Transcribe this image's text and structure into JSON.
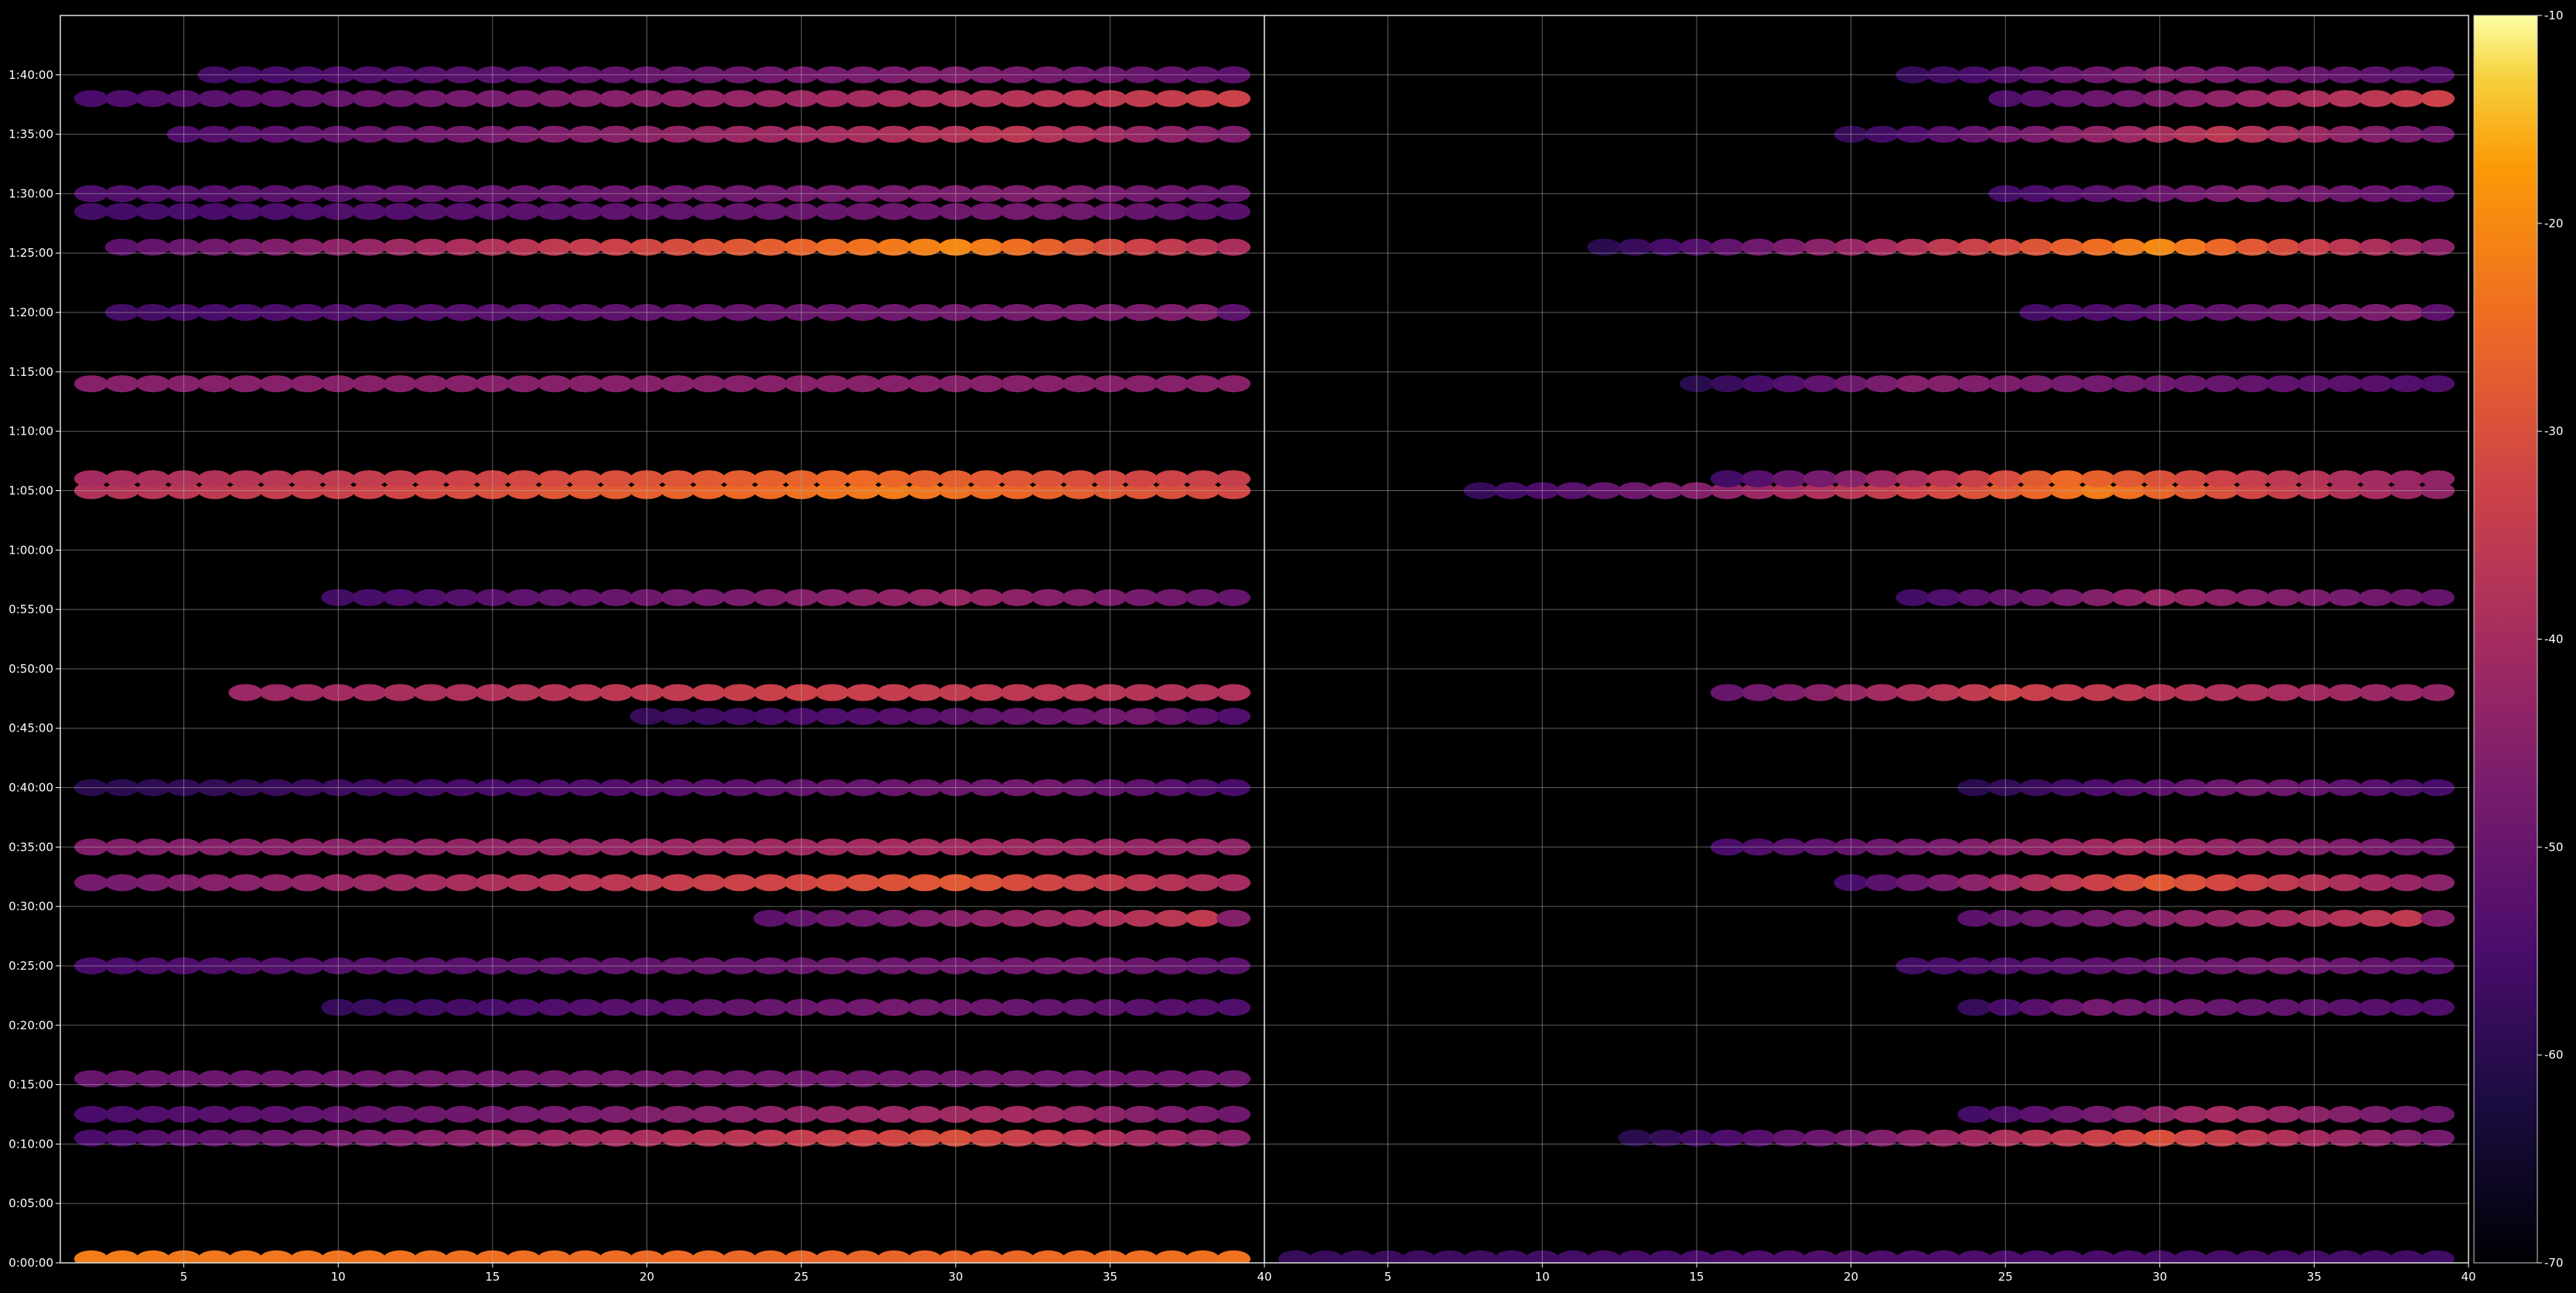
{
  "chart_data": {
    "type": "heatmap",
    "title": "",
    "background": "#000000",
    "grid": true,
    "colormap": "inferno",
    "colorbar": {
      "range": [
        -70,
        -10
      ],
      "ticks": [
        "-10",
        "-20",
        "-30",
        "-40",
        "-50",
        "-60",
        "-70"
      ],
      "tick_values": [
        -10,
        -20,
        -30,
        -40,
        -50,
        -60,
        -70
      ]
    },
    "y_axis": {
      "label": "",
      "range_seconds": [
        0,
        6300
      ],
      "ticks": [
        "0:00:00",
        "0:05:00",
        "0:10:00",
        "0:15:00",
        "0:20:00",
        "0:25:00",
        "0:30:00",
        "0:35:00",
        "0:40:00",
        "0:45:00",
        "0:50:00",
        "0:55:00",
        "1:00:00",
        "1:05:00",
        "1:10:00",
        "1:15:00",
        "1:20:00",
        "1:25:00",
        "1:30:00",
        "1:35:00",
        "1:40:00"
      ],
      "tick_seconds": [
        0,
        300,
        600,
        900,
        1200,
        1500,
        1800,
        2100,
        2400,
        2700,
        3000,
        3300,
        3600,
        3900,
        4200,
        4500,
        4800,
        5100,
        5400,
        5700,
        6000
      ]
    },
    "panels": [
      {
        "name": "",
        "x_range": [
          1,
          40
        ],
        "x_ticks": [
          "5",
          "10",
          "15",
          "20",
          "25",
          "30",
          "35",
          "40"
        ],
        "x_tick_values": [
          5,
          10,
          15,
          20,
          25,
          30,
          35,
          40
        ],
        "x_columns": [
          2,
          39
        ],
        "bands": [
          {
            "t": 20,
            "x_from": 2,
            "x_to": 39,
            "db_start": -22,
            "db_peak": -26,
            "peak_x": 28
          },
          {
            "t": 2880,
            "x_from": 7,
            "x_to": 39,
            "db_start": -42,
            "db_peak": -33,
            "peak_x": 25
          },
          {
            "t": 1920,
            "x_from": 2,
            "x_to": 39,
            "db_start": -48,
            "db_peak": -28,
            "peak_x": 30
          },
          {
            "t": 2100,
            "x_from": 2,
            "x_to": 39,
            "db_start": -46,
            "db_peak": -40,
            "peak_x": 29
          },
          {
            "t": 3900,
            "x_from": 2,
            "x_to": 39,
            "db_start": -38,
            "db_peak": -22,
            "peak_x": 28
          },
          {
            "t": 3960,
            "x_from": 2,
            "x_to": 39,
            "db_start": -40,
            "db_peak": -25,
            "peak_x": 27
          },
          {
            "t": 4440,
            "x_from": 2,
            "x_to": 39,
            "db_start": -45,
            "db_peak": -45,
            "peak_x": 20
          },
          {
            "t": 5130,
            "x_from": 3,
            "x_to": 39,
            "db_start": -52,
            "db_peak": -20,
            "peak_x": 30
          },
          {
            "t": 5700,
            "x_from": 5,
            "x_to": 39,
            "db_start": -54,
            "db_peak": -36,
            "peak_x": 32
          },
          {
            "t": 5880,
            "x_from": 2,
            "x_to": 39,
            "db_start": -55,
            "db_peak": -33,
            "peak_x": 39
          },
          {
            "t": 630,
            "x_from": 2,
            "x_to": 39,
            "db_start": -55,
            "db_peak": -30,
            "peak_x": 30
          },
          {
            "t": 750,
            "x_from": 2,
            "x_to": 39,
            "db_start": -55,
            "db_peak": -40,
            "peak_x": 32
          },
          {
            "t": 930,
            "x_from": 2,
            "x_to": 39,
            "db_start": -50,
            "db_peak": -48,
            "peak_x": 20
          },
          {
            "t": 1500,
            "x_from": 2,
            "x_to": 39,
            "db_start": -55,
            "db_peak": -48,
            "peak_x": 34
          },
          {
            "t": 1740,
            "x_from": 24,
            "x_to": 39,
            "db_start": -52,
            "db_peak": -35,
            "peak_x": 38
          },
          {
            "t": 3360,
            "x_from": 10,
            "x_to": 39,
            "db_start": -56,
            "db_peak": -42,
            "peak_x": 30
          },
          {
            "t": 4800,
            "x_from": 3,
            "x_to": 39,
            "db_start": -56,
            "db_peak": -46,
            "peak_x": 38
          },
          {
            "t": 5400,
            "x_from": 2,
            "x_to": 39,
            "db_start": -54,
            "db_peak": -46,
            "peak_x": 33
          },
          {
            "t": 5310,
            "x_from": 2,
            "x_to": 39,
            "db_start": -56,
            "db_peak": -48,
            "peak_x": 33
          },
          {
            "t": 6000,
            "x_from": 6,
            "x_to": 39,
            "db_start": -56,
            "db_peak": -46,
            "peak_x": 30
          },
          {
            "t": 2760,
            "x_from": 20,
            "x_to": 39,
            "db_start": -58,
            "db_peak": -48,
            "peak_x": 36
          },
          {
            "t": 2400,
            "x_from": 2,
            "x_to": 39,
            "db_start": -60,
            "db_peak": -48,
            "peak_x": 33
          },
          {
            "t": 1290,
            "x_from": 10,
            "x_to": 39,
            "db_start": -58,
            "db_peak": -48,
            "peak_x": 28
          }
        ]
      },
      {
        "name": "",
        "x_range": [
          1,
          40
        ],
        "x_ticks": [
          "5",
          "10",
          "15",
          "20",
          "25",
          "30",
          "35",
          "40"
        ],
        "x_tick_values": [
          5,
          10,
          15,
          20,
          25,
          30,
          35,
          40
        ],
        "x_columns": [
          2,
          39
        ],
        "bands": [
          {
            "t": 20,
            "x_from": 2,
            "x_to": 39,
            "db_start": -58,
            "db_peak": -54,
            "peak_x": 20
          },
          {
            "t": 2880,
            "x_from": 16,
            "x_to": 39,
            "db_start": -50,
            "db_peak": -33,
            "peak_x": 25
          },
          {
            "t": 1920,
            "x_from": 20,
            "x_to": 39,
            "db_start": -55,
            "db_peak": -28,
            "peak_x": 30
          },
          {
            "t": 2100,
            "x_from": 16,
            "x_to": 39,
            "db_start": -55,
            "db_peak": -40,
            "peak_x": 29
          },
          {
            "t": 3900,
            "x_from": 8,
            "x_to": 39,
            "db_start": -58,
            "db_peak": -22,
            "peak_x": 28
          },
          {
            "t": 3960,
            "x_from": 16,
            "x_to": 39,
            "db_start": -56,
            "db_peak": -25,
            "peak_x": 27
          },
          {
            "t": 4440,
            "x_from": 15,
            "x_to": 39,
            "db_start": -60,
            "db_peak": -45,
            "peak_x": 22
          },
          {
            "t": 5130,
            "x_from": 12,
            "x_to": 39,
            "db_start": -60,
            "db_peak": -20,
            "peak_x": 30
          },
          {
            "t": 5700,
            "x_from": 20,
            "x_to": 39,
            "db_start": -58,
            "db_peak": -36,
            "peak_x": 32
          },
          {
            "t": 5880,
            "x_from": 25,
            "x_to": 39,
            "db_start": -54,
            "db_peak": -33,
            "peak_x": 39
          },
          {
            "t": 630,
            "x_from": 13,
            "x_to": 39,
            "db_start": -60,
            "db_peak": -30,
            "peak_x": 30
          },
          {
            "t": 750,
            "x_from": 24,
            "x_to": 39,
            "db_start": -56,
            "db_peak": -40,
            "peak_x": 32
          },
          {
            "t": 1500,
            "x_from": 22,
            "x_to": 39,
            "db_start": -56,
            "db_peak": -48,
            "peak_x": 34
          },
          {
            "t": 1740,
            "x_from": 24,
            "x_to": 39,
            "db_start": -52,
            "db_peak": -35,
            "peak_x": 38
          },
          {
            "t": 3360,
            "x_from": 22,
            "x_to": 39,
            "db_start": -56,
            "db_peak": -42,
            "peak_x": 30
          },
          {
            "t": 4800,
            "x_from": 26,
            "x_to": 39,
            "db_start": -56,
            "db_peak": -46,
            "peak_x": 38
          },
          {
            "t": 5400,
            "x_from": 25,
            "x_to": 39,
            "db_start": -56,
            "db_peak": -46,
            "peak_x": 33
          },
          {
            "t": 6000,
            "x_from": 22,
            "x_to": 39,
            "db_start": -58,
            "db_peak": -46,
            "peak_x": 30
          },
          {
            "t": 2400,
            "x_from": 24,
            "x_to": 39,
            "db_start": -60,
            "db_peak": -48,
            "peak_x": 33
          },
          {
            "t": 1290,
            "x_from": 24,
            "x_to": 39,
            "db_start": -58,
            "db_peak": -48,
            "peak_x": 28
          }
        ]
      }
    ]
  }
}
